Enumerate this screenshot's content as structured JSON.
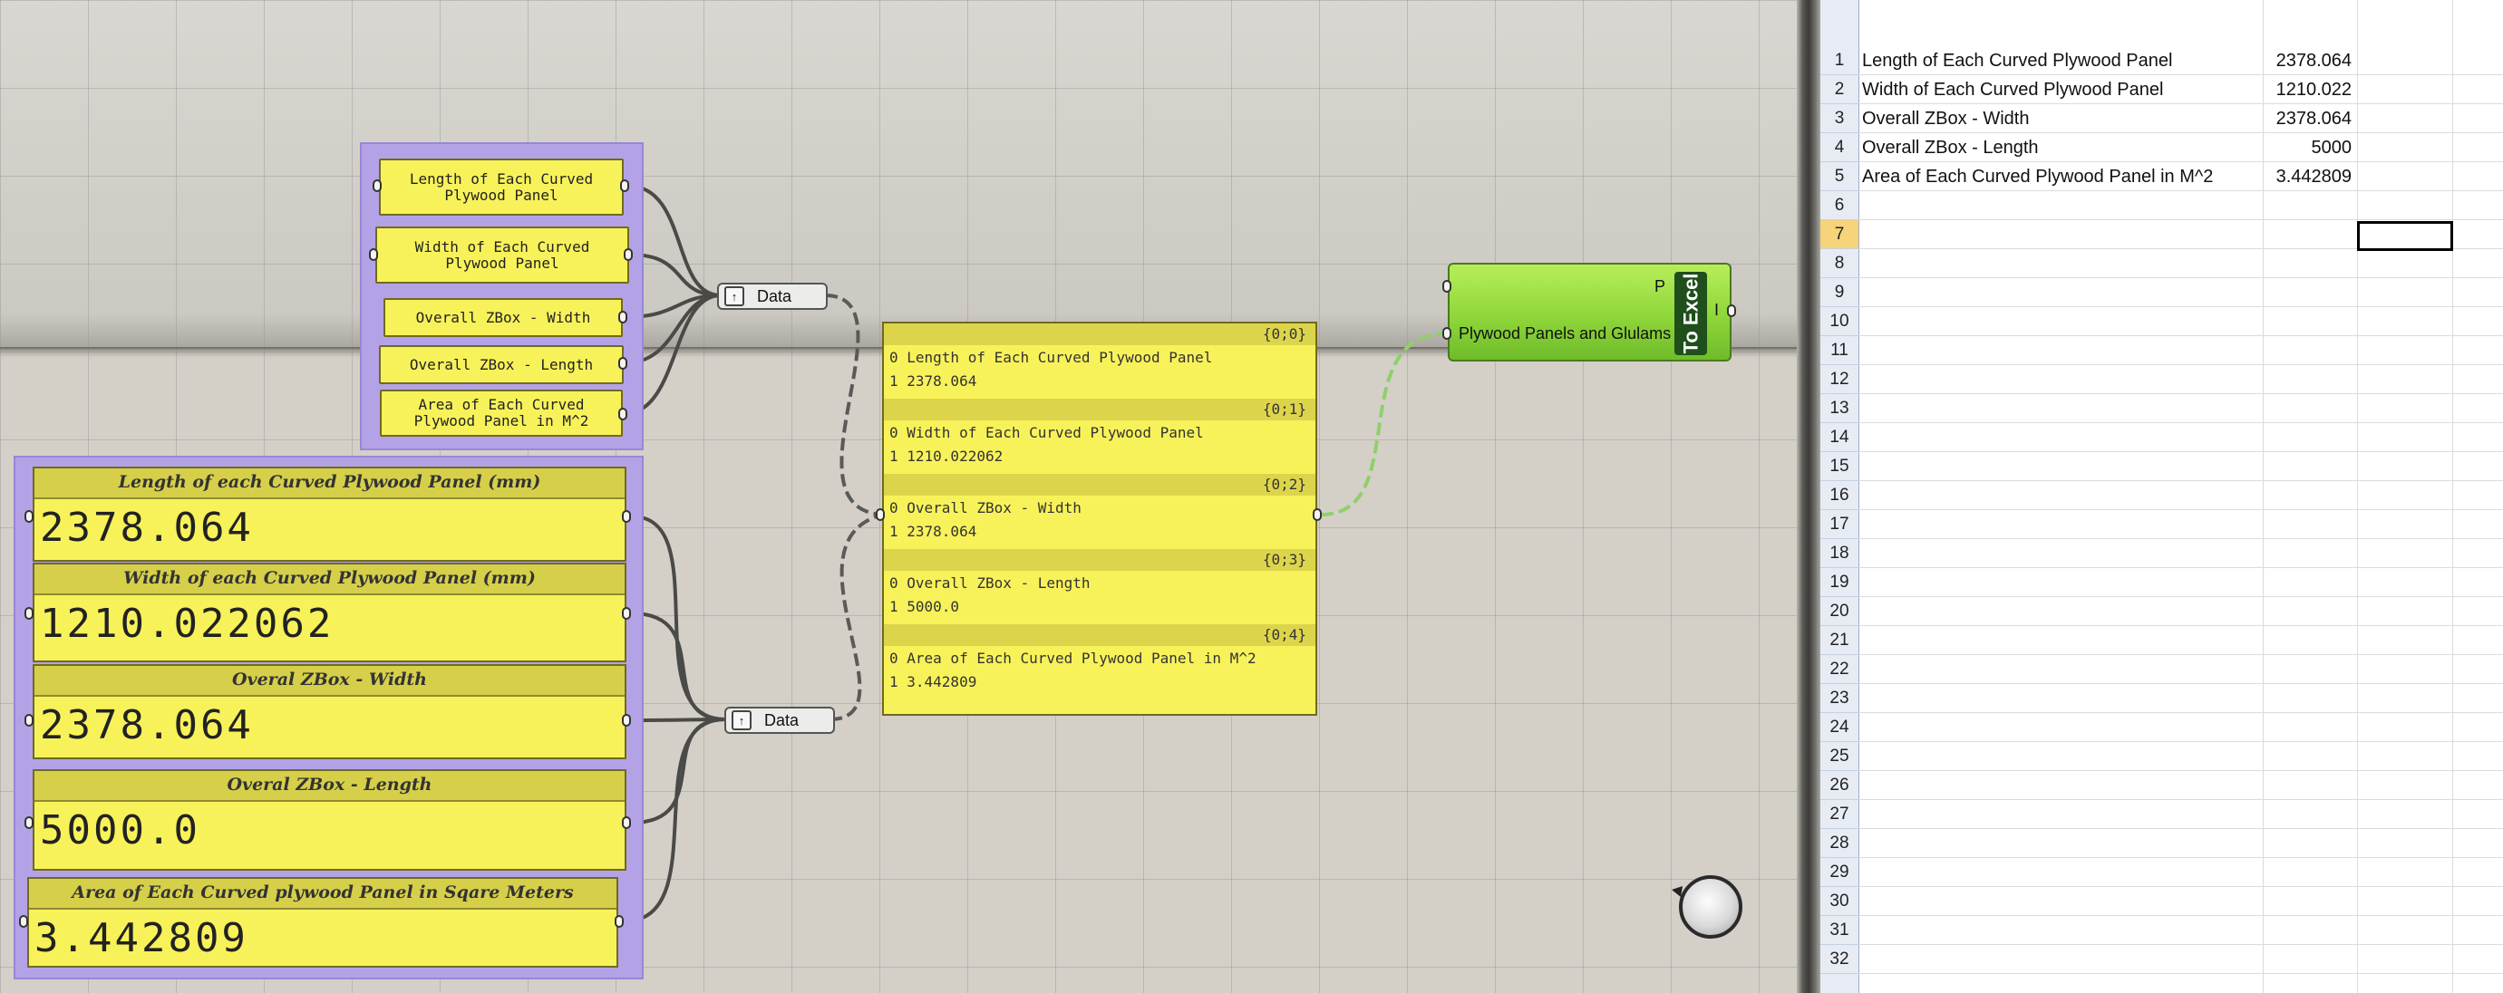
{
  "canvas": {
    "top_group_panels": [
      {
        "text": "Length of Each Curved Plywood Panel"
      },
      {
        "text": "Width of Each Curved Plywood Panel"
      },
      {
        "text": "Overall ZBox - Width"
      },
      {
        "text": "Overall ZBox - Length"
      },
      {
        "text": "Area of Each Curved Plywood Panel in M^2"
      }
    ],
    "number_panels": [
      {
        "title": "Length of each Curved Plywood Panel (mm)",
        "value": "2378.064"
      },
      {
        "title": "Width of each Curved Plywood Panel (mm)",
        "value": "1210.022062"
      },
      {
        "title": "Overal ZBox - Width",
        "value": "2378.064"
      },
      {
        "title": "Overal ZBox - Length",
        "value": "5000.0"
      },
      {
        "title": "Area of Each Curved plywood Panel in Sqare Meters",
        "value": "3.442809"
      }
    ],
    "data_node_top": {
      "label": "Data"
    },
    "data_node_bottom": {
      "label": "Data"
    },
    "param_viewer": {
      "branches": [
        {
          "path": "{0;0}",
          "row0": "0 Length of Each Curved Plywood Panel",
          "row1": "1 2378.064"
        },
        {
          "path": "{0;1}",
          "row0": "0 Width of Each Curved Plywood Panel",
          "row1": "1 1210.022062"
        },
        {
          "path": "{0;2}",
          "row0": "0 Overall ZBox - Width",
          "row1": "1 2378.064"
        },
        {
          "path": "{0;3}",
          "row0": "0 Overall ZBox - Length",
          "row1": "1 5000.0"
        },
        {
          "path": "{0;4}",
          "row0": "0 Area of Each Curved Plywood Panel in M^2",
          "row1": "1 3.442809"
        }
      ]
    },
    "to_excel": {
      "input_p": "P",
      "input_label": "Plywood Panels and Glulams",
      "title": "To Excel",
      "output_i": "I"
    }
  },
  "excel": {
    "row_numbers": [
      "1",
      "2",
      "3",
      "4",
      "5",
      "6",
      "7",
      "8",
      "9",
      "10",
      "11",
      "12",
      "13",
      "14",
      "15",
      "16",
      "17",
      "18",
      "19",
      "20",
      "21",
      "22",
      "23",
      "24",
      "25",
      "26",
      "27",
      "28",
      "29",
      "30",
      "31",
      "32"
    ],
    "active_row": "7",
    "rows": [
      {
        "label": "Length of Each Curved Plywood Panel",
        "value": "2378.064"
      },
      {
        "label": "Width of Each Curved Plywood Panel",
        "value": "1210.022"
      },
      {
        "label": "Overall ZBox - Width",
        "value": "2378.064"
      },
      {
        "label": "Overall ZBox - Length",
        "value": "5000"
      },
      {
        "label": "Area of Each Curved Plywood Panel in M^2",
        "value": "3.442809"
      }
    ]
  }
}
